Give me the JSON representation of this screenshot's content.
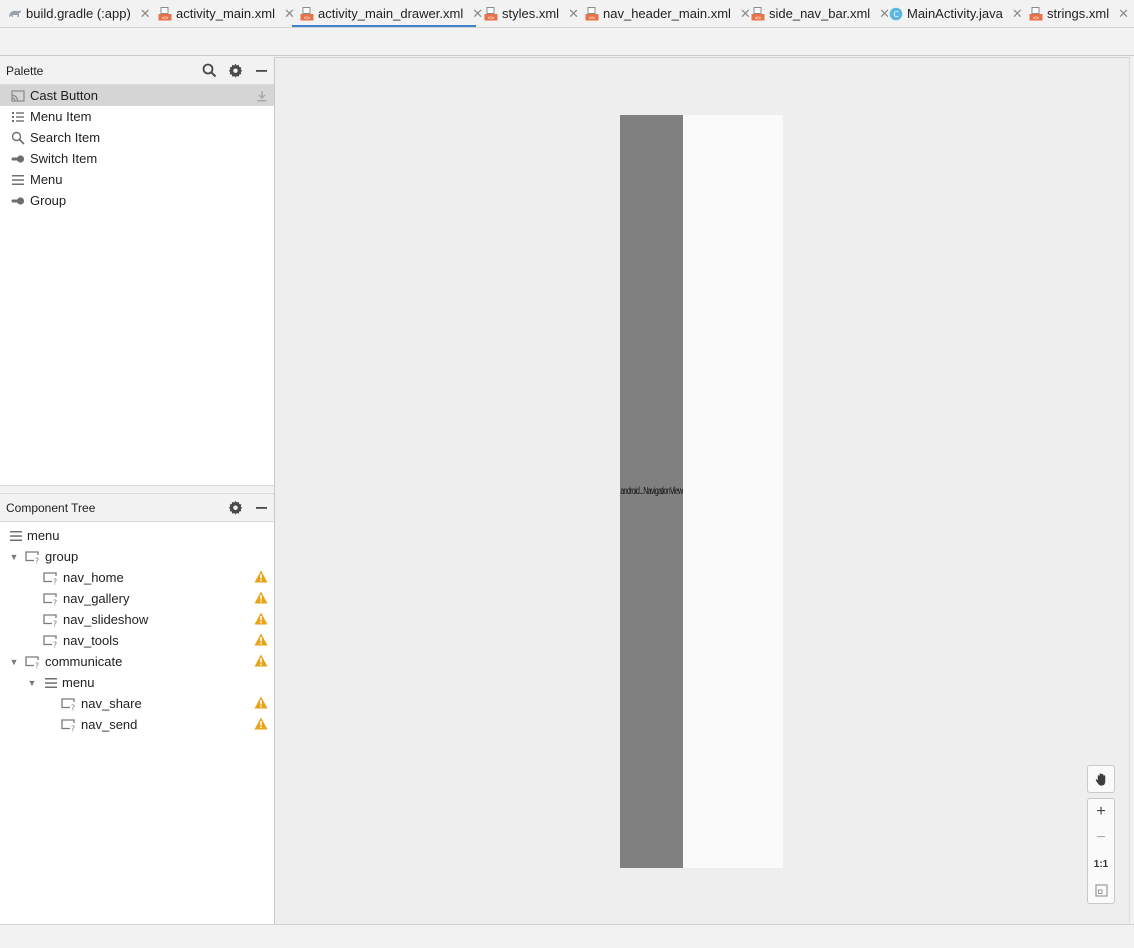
{
  "tabs": [
    {
      "label": "build.gradle (:app)",
      "icon": "gradle-icon"
    },
    {
      "label": "activity_main.xml",
      "icon": "layout-xml-icon"
    },
    {
      "label": "activity_main_drawer.xml",
      "icon": "layout-xml-icon",
      "active": true
    },
    {
      "label": "styles.xml",
      "icon": "layout-xml-icon"
    },
    {
      "label": "nav_header_main.xml",
      "icon": "layout-xml-icon"
    },
    {
      "label": "side_nav_bar.xml",
      "icon": "layout-xml-icon"
    },
    {
      "label": "MainActivity.java",
      "icon": "java-class-icon"
    },
    {
      "label": "strings.xml",
      "icon": "layout-xml-icon"
    }
  ],
  "palette": {
    "title": "Palette",
    "items": [
      {
        "label": "Cast Button",
        "icon": "cast-icon"
      },
      {
        "label": "Menu Item",
        "icon": "list-icon"
      },
      {
        "label": "Search Item",
        "icon": "search-icon"
      },
      {
        "label": "Switch Item",
        "icon": "switch-icon"
      },
      {
        "label": "Menu",
        "icon": "menu-icon"
      },
      {
        "label": "Group",
        "icon": "switch-icon"
      }
    ]
  },
  "component_tree": {
    "title": "Component Tree",
    "rows": [
      {
        "label": "menu",
        "icon": "menu-icon",
        "expandable": false,
        "warning": false
      },
      {
        "label": "group",
        "icon": "unknown-view-icon",
        "expandable": true,
        "warning": false
      },
      {
        "label": "nav_home",
        "icon": "unknown-view-icon",
        "expandable": false,
        "warning": true
      },
      {
        "label": "nav_gallery",
        "icon": "unknown-view-icon",
        "expandable": false,
        "warning": true
      },
      {
        "label": "nav_slideshow",
        "icon": "unknown-view-icon",
        "expandable": false,
        "warning": true
      },
      {
        "label": "nav_tools",
        "icon": "unknown-view-icon",
        "expandable": false,
        "warning": true
      },
      {
        "label": "communicate",
        "icon": "unknown-view-icon",
        "expandable": true,
        "warning": true
      },
      {
        "label": "menu",
        "icon": "menu-icon",
        "expandable": true,
        "warning": false
      },
      {
        "label": "nav_share",
        "icon": "unknown-view-icon",
        "expandable": false,
        "warning": true
      },
      {
        "label": "nav_send",
        "icon": "unknown-view-icon",
        "expandable": false,
        "warning": true
      }
    ]
  },
  "design": {
    "navigation_view_label": "android...NavigationView"
  },
  "zoom": {
    "pan_icon": "hand-icon",
    "zoom_in": "+",
    "zoom_out": "−",
    "actual_size": "1:1",
    "fit_icon": "fit-screen-icon"
  },
  "colors": {
    "accent": "#4083c9",
    "warning": "#e8a317",
    "navigation_view": "#808080",
    "xml_icon": "#e8734a",
    "java_icon": "#5bb7e0"
  }
}
